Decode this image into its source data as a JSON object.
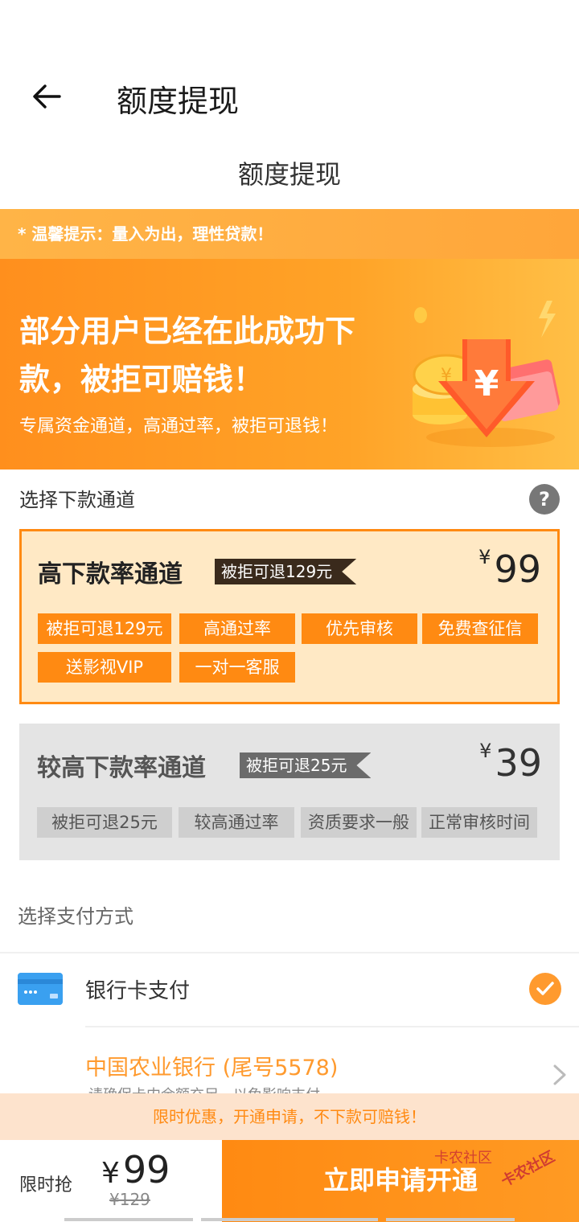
{
  "header": {
    "title": "额度提现",
    "subtitle": "额度提现"
  },
  "tip": "* 温馨提示：量入为出，理性贷款！",
  "banner": {
    "headline": "部分用户已经在此成功下款，被拒可赔钱！",
    "subtext": "专属资金通道，高通过率，被拒可退钱！"
  },
  "channel_section": {
    "label": "选择下款通道"
  },
  "channels": [
    {
      "name": "高下款率通道",
      "ribbon": "被拒可退129元",
      "currency": "¥",
      "price": "99",
      "selected": true,
      "tags": [
        "被拒可退129元",
        "高通过率",
        "优先审核",
        "免费查征信",
        "送影视VIP",
        "一对一客服"
      ]
    },
    {
      "name": "较高下款率通道",
      "ribbon": "被拒可退25元",
      "currency": "¥",
      "price": "39",
      "selected": false,
      "tags": [
        "被拒可退25元",
        "较高通过率",
        "资质要求一般",
        "正常审核时间"
      ]
    }
  ],
  "payment": {
    "label": "选择支付方式",
    "method": "银行卡支付",
    "bank": "中国农业银行 (尾号5578)",
    "note": "请确保卡内余额充足，以免影响支付"
  },
  "promo": "限时优惠，开通申请，不下款可赔钱！",
  "bottom": {
    "limit_label": "限时抢",
    "currency": "¥",
    "price": "99",
    "old_price": "¥129",
    "cta": "立即申请开通"
  },
  "watermark": {
    "primary": "卡农社区",
    "secondary": "卡农社区"
  },
  "colors": {
    "accent": "#ff8a12",
    "selected_bg": "#ffe9c5",
    "bank_text": "#ff9a2e"
  }
}
